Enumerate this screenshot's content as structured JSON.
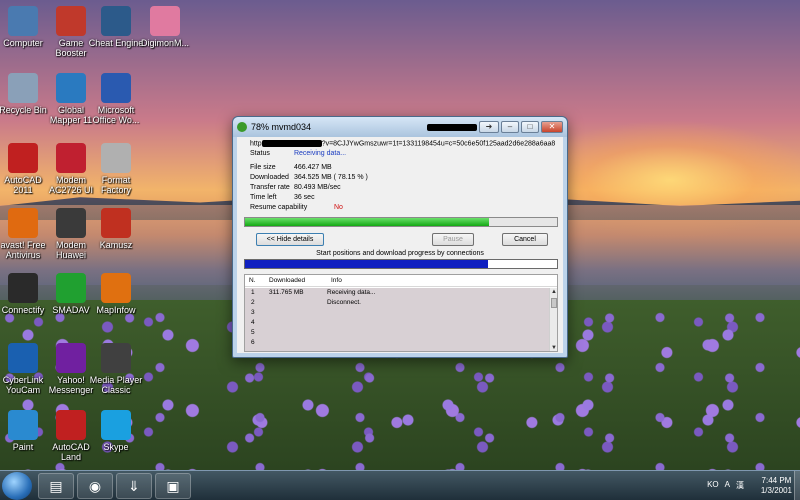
{
  "desktop_icons": [
    {
      "label": "Computer",
      "icon": "computer-icon",
      "color": "#4a7ab0"
    },
    {
      "label": "Game\nBooster",
      "icon": "game-booster-icon",
      "color": "#c0392b"
    },
    {
      "label": "Cheat Engine",
      "icon": "cheat-engine-icon",
      "color": "#2c5a8a"
    },
    {
      "label": "DigimonM...",
      "icon": "digimon-icon",
      "color": "#e07aa0"
    },
    {
      "label": "Recycle Bin",
      "icon": "recycle-bin-icon",
      "color": "#8aa0b8"
    },
    {
      "label": "Global\nMapper 11",
      "icon": "global-mapper-icon",
      "color": "#2a7ac0"
    },
    {
      "label": "Microsoft\nOffice Wo...",
      "icon": "word-icon",
      "color": "#2a5ab0"
    },
    {
      "label": "AutoCAD\n2011",
      "icon": "autocad-icon",
      "color": "#c02020"
    },
    {
      "label": "Modem\nAC2726 UI",
      "icon": "smartfren-icon",
      "color": "#c02030"
    },
    {
      "label": "Format\nFactory",
      "icon": "format-factory-icon",
      "color": "#b0b0b0"
    },
    {
      "label": "avast! Free\nAntivirus",
      "icon": "avast-icon",
      "color": "#e06a10"
    },
    {
      "label": "Modem\nHuawei",
      "icon": "huawei-modem-icon",
      "color": "#3a3a3a"
    },
    {
      "label": "Kamusz",
      "icon": "kamusz-icon",
      "color": "#c03020"
    },
    {
      "label": "Connectify",
      "icon": "connectify-icon",
      "color": "#2a2a2a"
    },
    {
      "label": "SMADAV",
      "icon": "smadav-icon",
      "color": "#20a030"
    },
    {
      "label": "MapInfow",
      "icon": "mapinfo-icon",
      "color": "#e07010"
    },
    {
      "label": "CyberLink\nYouCam",
      "icon": "youcam-icon",
      "color": "#1a60b0"
    },
    {
      "label": "Yahoo!\nMessenger",
      "icon": "yahoo-messenger-icon",
      "color": "#7020a0"
    },
    {
      "label": "Media Player\nClassic",
      "icon": "media-player-classic-icon",
      "color": "#404040"
    },
    {
      "label": "Paint",
      "icon": "paint-icon",
      "color": "#2a8ad0"
    },
    {
      "label": "AutoCAD\nLand",
      "icon": "autocad-land-icon",
      "color": "#c02020"
    },
    {
      "label": "Skype",
      "icon": "skype-icon",
      "color": "#1aa0e0"
    }
  ],
  "window": {
    "title": "78% mvmd034",
    "url_prefix": "http",
    "url_suffix": "?v=8CJJYwGmszuwr=1t=1331198454u=c=50c6e50f125aad2d6e288a6aa8",
    "status_label": "Status",
    "status_value": "Receiving data...",
    "file_size_label": "File size",
    "file_size_value": "466.427  MB",
    "downloaded_label": "Downloaded",
    "downloaded_value": "364.525  MB  ( 78.15 % )",
    "rate_label": "Transfer rate",
    "rate_value": "80.493  MB/sec",
    "time_left_label": "Time left",
    "time_left_value": "36 sec",
    "resume_label": "Resume capability",
    "resume_value": "No",
    "progress_percent": 78.15,
    "hide_details_label": "<< Hide details",
    "pause_label": "Pause",
    "cancel_label": "Cancel",
    "connections_caption": "Start positions and download progress by connections",
    "connections_progress_percent": 78,
    "table": {
      "headers": [
        "N.",
        "Downloaded",
        "Info"
      ],
      "rows": [
        {
          "n": "1",
          "downloaded": "311.765  MB",
          "info": "Receiving data..."
        },
        {
          "n": "2",
          "downloaded": "",
          "info": "Disconnect."
        },
        {
          "n": "3",
          "downloaded": "",
          "info": ""
        },
        {
          "n": "4",
          "downloaded": "",
          "info": ""
        },
        {
          "n": "5",
          "downloaded": "",
          "info": ""
        },
        {
          "n": "6",
          "downloaded": "",
          "info": ""
        }
      ]
    }
  },
  "taskbar": {
    "apps": [
      {
        "name": "windows-explorer-icon",
        "glyph": "▤"
      },
      {
        "name": "chrome-icon",
        "glyph": "◉"
      },
      {
        "name": "idm-icon",
        "glyph": "⇓"
      },
      {
        "name": "media-player-classic-taskbar-icon",
        "glyph": "▣"
      }
    ],
    "tray": [
      "KO",
      "A",
      "漢"
    ],
    "time": "7:44 PM",
    "date": "1/3/2001"
  }
}
